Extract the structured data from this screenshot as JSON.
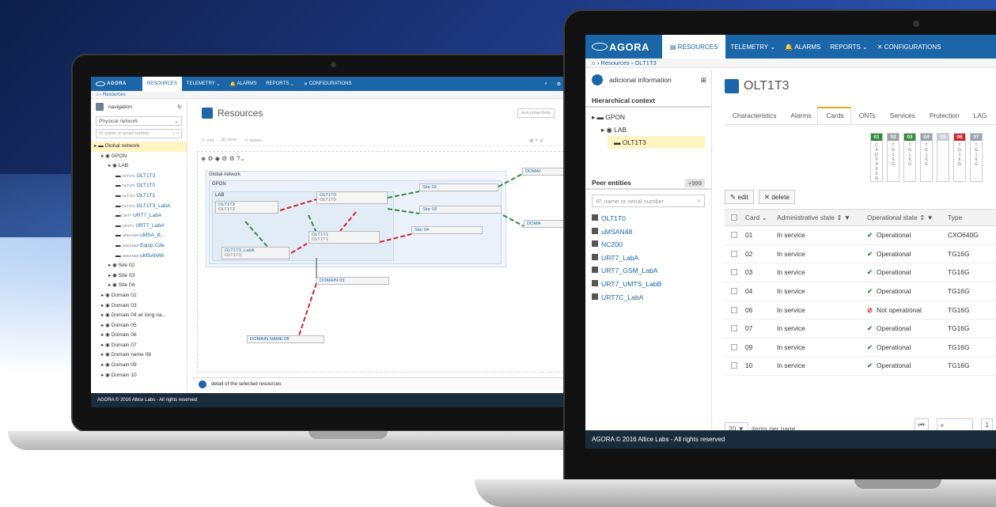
{
  "brand": {
    "logo": "AGORA",
    "accent": "#1a66a8",
    "footer_bg": "#1a2b3b",
    "ok_color": "#2e8b3a",
    "bad_color": "#d0262a"
  },
  "left": {
    "topbar": {
      "resources": "RESOURCES",
      "telemetry": "TELEMETRY",
      "alarms": "ALARMS",
      "reports": "REPORTS",
      "configurations": "CONFIGURATIONS"
    },
    "breadcrumb": "Resources",
    "nav": {
      "title": "navigation",
      "network_select": "Physical network",
      "search_placeholder": "IP, name or serial number"
    },
    "tree": [
      {
        "label": "Global network",
        "indent": 0,
        "hl": true
      },
      {
        "label": "GPON",
        "indent": 1
      },
      {
        "label": "LAB",
        "indent": 2
      },
      {
        "label": "OLT1T3",
        "tag": "OLT1T3",
        "indent": 3,
        "blue": true
      },
      {
        "label": "OLT1T0",
        "tag": "OLT1T0",
        "indent": 3,
        "blue": true
      },
      {
        "label": "OLT1T1",
        "tag": "OLT1T1",
        "indent": 3,
        "blue": true
      },
      {
        "label": "OLT1T3_LabA",
        "tag": "OLT1T3",
        "indent": 3,
        "blue": true
      },
      {
        "label": "URT7_LabA",
        "tag": "URT7",
        "indent": 3,
        "blue": true
      },
      {
        "label": "URT7_LabA",
        "tag": "URT7C",
        "indent": 3,
        "blue": true
      },
      {
        "label": "uMSA_B...",
        "tag": "uMSAN48",
        "indent": 3,
        "blue": true
      },
      {
        "label": "Equip Cde",
        "tag": "uMSAN48",
        "indent": 3,
        "blue": true
      },
      {
        "label": "uMSAN48",
        "tag": "uMSAN48",
        "indent": 3,
        "blue": true
      },
      {
        "label": "Site 02",
        "indent": 2
      },
      {
        "label": "Site 03",
        "indent": 2
      },
      {
        "label": "Site 04",
        "indent": 2
      },
      {
        "label": "Domain 02",
        "indent": 1
      },
      {
        "label": "Domain 03",
        "indent": 1
      },
      {
        "label": "Domain 04 w/ long na...",
        "indent": 1
      },
      {
        "label": "Domain 05",
        "indent": 1
      },
      {
        "label": "Domain 06",
        "indent": 1
      },
      {
        "label": "Domain 07",
        "indent": 1
      },
      {
        "label": "Domain name 08",
        "indent": 1
      },
      {
        "label": "Domain 09",
        "indent": 1
      },
      {
        "label": "Domain 10",
        "indent": 1
      }
    ],
    "page_title": "Resources",
    "test_conn": "test conectivity",
    "toolbar": {
      "edit": "edit",
      "clone": "clone",
      "delete": "delete"
    },
    "graph": {
      "global": "Global network",
      "gpon": "GPON",
      "lab": "LAB",
      "olt1t3": "OLT1T3",
      "olt1t3_sub": "OLT1T3",
      "olt1t0": "OLT1T0",
      "olt1t0_sub": "OLT1T0",
      "olt1t1": "OLT1T1",
      "olt1t1_sub": "OLT1T1",
      "olt1t3laba": "OLT1T3_LabA",
      "olt1t3laba_sub": "OLT1T3",
      "site02": "Site 02",
      "site03": "Site 03",
      "site04": "Site 04",
      "domain03": "DOMAIN 03",
      "domain08": "DOMAIN NAME 08",
      "domain_r1": "DOMAI",
      "domain_r2": "DOMA"
    },
    "detail": "detail of the selected resources",
    "footer": "AGORA © 2016 Altice Labs - All rights reserved"
  },
  "right": {
    "topbar": {
      "resources": "RESOURCES",
      "telemetry": "TELEMETRY",
      "alarms": "ALARMS",
      "reports": "REPORTS",
      "configurations": "CONFIGURATIONS"
    },
    "breadcrumb": {
      "resources": "Resources",
      "current": "OLT1T3"
    },
    "addinfo": "adicional information",
    "hc_title": "Hierarchical context",
    "hc_tree": {
      "gpon": "GPON",
      "lab": "LAB",
      "olt": "OLT1T3"
    },
    "peer_title": "Peer entities",
    "peer_count": "+999",
    "peer_search": "IP, name or serial number",
    "peers": [
      "OLT1T0",
      "uMSAN48",
      "NC200",
      "URT7_LabA",
      "URT7_GSM_LabA",
      "URT7_UMTS_LabB",
      "URT7C_LabA"
    ],
    "page_title": "OLT1T3",
    "tabs": [
      "Characteristics",
      "Alarms",
      "Cards",
      "ONTs",
      "Services",
      "Protection",
      "LAG"
    ],
    "active_tab": 2,
    "cards": [
      {
        "n": "01",
        "color": "#2e8b3a",
        "txt": "CXO6400G"
      },
      {
        "n": "02",
        "color": "#9aa3ab",
        "txt": "TG16G"
      },
      {
        "n": "03",
        "color": "#2e8b3a",
        "txt": "TG16G"
      },
      {
        "n": "04",
        "color": "#9aa3ab",
        "txt": "TG16G"
      },
      {
        "n": "05",
        "color": "#c9cfd4",
        "txt": ""
      },
      {
        "n": "06",
        "color": "#d0262a",
        "txt": "TG16G"
      },
      {
        "n": "07",
        "color": "#9aa3ab",
        "txt": "TG16G"
      }
    ],
    "actions": {
      "edit": "edit",
      "delete": "delete"
    },
    "columns": {
      "card": "Card",
      "admin": "Administrative state",
      "oper": "Operational state",
      "type": "Type"
    },
    "rows": [
      {
        "card": "01",
        "admin": "In service",
        "oper": "Operational",
        "ok": true,
        "type": "CXO640G"
      },
      {
        "card": "02",
        "admin": "In service",
        "oper": "Operational",
        "ok": true,
        "type": "TG16G"
      },
      {
        "card": "03",
        "admin": "In service",
        "oper": "Operational",
        "ok": true,
        "type": "TG16G"
      },
      {
        "card": "04",
        "admin": "In service",
        "oper": "Operational",
        "ok": true,
        "type": "TG16G"
      },
      {
        "card": "06",
        "admin": "In service",
        "oper": "Not operational",
        "ok": false,
        "type": "TG16G"
      },
      {
        "card": "07",
        "admin": "In service",
        "oper": "Operational",
        "ok": true,
        "type": "TG16G"
      },
      {
        "card": "09",
        "admin": "In service",
        "oper": "Operational",
        "ok": true,
        "type": "TG16G"
      },
      {
        "card": "10",
        "admin": "In service",
        "oper": "Operational",
        "ok": true,
        "type": "TG16G"
      }
    ],
    "pager": {
      "per_page": "20",
      "per_page_label": "items per page",
      "previous": "previous",
      "page": "1"
    },
    "footer": "AGORA © 2016 Altice Labs - All rights reserved"
  }
}
